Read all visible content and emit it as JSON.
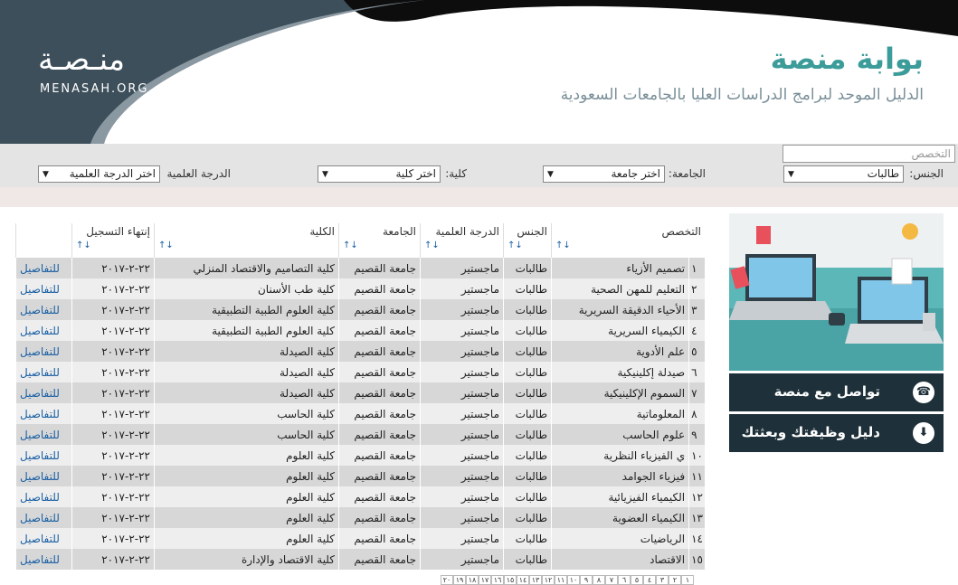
{
  "header": {
    "logo_ar": "منـصـة",
    "logo_en": "MENASAH.ORG",
    "title": "بوابة منصة",
    "subtitle": "الدليل الموحد لبرامج الدراسات العليا بالجامعات السعودية",
    "colors": {
      "dark": "#3d4f5a",
      "accent": "#3c9c9a"
    }
  },
  "filters": {
    "search_placeholder": "التخصص",
    "gender_label": "الجنس:",
    "gender_value": "طالبات",
    "university_label": "الجامعة:",
    "university_value": "اختر جامعة",
    "college_label": "كلية:",
    "college_value": "اختر كلية",
    "degree_label": "الدرجة العلمية",
    "degree_value": "اختر الدرجة العلمية"
  },
  "table": {
    "headers": [
      "التخصص",
      "الجنس",
      "الدرجة العلمية",
      "الجامعة",
      "الكلية",
      "إنتهاء التسجيل",
      ""
    ],
    "sort_icon": "↓↑",
    "rows": [
      {
        "n": "١",
        "major": "تصميم الأزياء",
        "gender": "طالبات",
        "degree": "ماجستير",
        "uni": "جامعة القصيم",
        "college": "كلية التصاميم والاقتصاد المنزلي",
        "date": "٢٢-٢-٢٠١٧",
        "link": "للتفاصيل"
      },
      {
        "n": "٢",
        "major": "التعليم للمهن الصحية",
        "gender": "طالبات",
        "degree": "ماجستير",
        "uni": "جامعة القصيم",
        "college": "كلية طب الأسنان",
        "date": "٢٢-٢-٢٠١٧",
        "link": "للتفاصيل"
      },
      {
        "n": "٣",
        "major": "الأحياء الدقيقة السريرية",
        "gender": "طالبات",
        "degree": "ماجستير",
        "uni": "جامعة القصيم",
        "college": "كلية العلوم الطبية التطبيقية",
        "date": "٢٢-٢-٢٠١٧",
        "link": "للتفاصيل"
      },
      {
        "n": "٤",
        "major": "الكيمياء السريرية",
        "gender": "طالبات",
        "degree": "ماجستير",
        "uni": "جامعة القصيم",
        "college": "كلية العلوم الطبية التطبيقية",
        "date": "٢٢-٢-٢٠١٧",
        "link": "للتفاصيل"
      },
      {
        "n": "٥",
        "major": "علم الأدوية",
        "gender": "طالبات",
        "degree": "ماجستير",
        "uni": "جامعة القصيم",
        "college": "كلية الصيدلة",
        "date": "٢٢-٢-٢٠١٧",
        "link": "للتفاصيل"
      },
      {
        "n": "٦",
        "major": "صيدلة إكلينيكية",
        "gender": "طالبات",
        "degree": "ماجستير",
        "uni": "جامعة القصيم",
        "college": "كلية الصيدلة",
        "date": "٢٢-٢-٢٠١٧",
        "link": "للتفاصيل"
      },
      {
        "n": "٧",
        "major": "السموم الإكلينيكية",
        "gender": "طالبات",
        "degree": "ماجستير",
        "uni": "جامعة القصيم",
        "college": "كلية الصيدلة",
        "date": "٢٢-٢-٢٠١٧",
        "link": "للتفاصيل"
      },
      {
        "n": "٨",
        "major": "المعلوماتية",
        "gender": "طالبات",
        "degree": "ماجستير",
        "uni": "جامعة القصيم",
        "college": "كلية الحاسب",
        "date": "٢٢-٢-٢٠١٧",
        "link": "للتفاصيل"
      },
      {
        "n": "٩",
        "major": "علوم الحاسب",
        "gender": "طالبات",
        "degree": "ماجستير",
        "uni": "جامعة القصيم",
        "college": "كلية الحاسب",
        "date": "٢٢-٢-٢٠١٧",
        "link": "للتفاصيل"
      },
      {
        "n": "١٠",
        "major": "ي الفيزياء النظرية",
        "gender": "طالبات",
        "degree": "ماجستير",
        "uni": "جامعة القصيم",
        "college": "كلية العلوم",
        "date": "٢٢-٢-٢٠١٧",
        "link": "للتفاصيل"
      },
      {
        "n": "١١",
        "major": "فيزياء الجوامد",
        "gender": "طالبات",
        "degree": "ماجستير",
        "uni": "جامعة القصيم",
        "college": "كلية العلوم",
        "date": "٢٢-٢-٢٠١٧",
        "link": "للتفاصيل"
      },
      {
        "n": "١٢",
        "major": "الكيمياء الفيزيائية",
        "gender": "طالبات",
        "degree": "ماجستير",
        "uni": "جامعة القصيم",
        "college": "كلية العلوم",
        "date": "٢٢-٢-٢٠١٧",
        "link": "للتفاصيل"
      },
      {
        "n": "١٣",
        "major": "الكيمياء العضوية",
        "gender": "طالبات",
        "degree": "ماجستير",
        "uni": "جامعة القصيم",
        "college": "كلية العلوم",
        "date": "٢٢-٢-٢٠١٧",
        "link": "للتفاصيل"
      },
      {
        "n": "١٤",
        "major": "الرياضيات",
        "gender": "طالبات",
        "degree": "ماجستير",
        "uni": "جامعة القصيم",
        "college": "كلية العلوم",
        "date": "٢٢-٢-٢٠١٧",
        "link": "للتفاصيل"
      },
      {
        "n": "١٥",
        "major": "الاقتصاد",
        "gender": "طالبات",
        "degree": "ماجستير",
        "uni": "جامعة القصيم",
        "college": "كلية الاقتصاد والإدارة",
        "date": "٢٢-٢-٢٠١٧",
        "link": "للتفاصيل"
      }
    ]
  },
  "pagination": [
    "١",
    "٢",
    "٣",
    "٤",
    "٥",
    "٦",
    "٧",
    "٨",
    "٩",
    "١٠",
    "١١",
    "١٢",
    "١٣",
    "١٤",
    "١٥",
    "١٦",
    "١٧",
    "١٨",
    "١٩",
    "٢٠"
  ],
  "sidebar": {
    "contact_label": "تواصل مع منصة",
    "contact_icon": "phone-icon",
    "guide_label": "دليل وظيفتك وبعثتك",
    "guide_icon": "download-icon",
    "button_color": "#1e3039"
  }
}
